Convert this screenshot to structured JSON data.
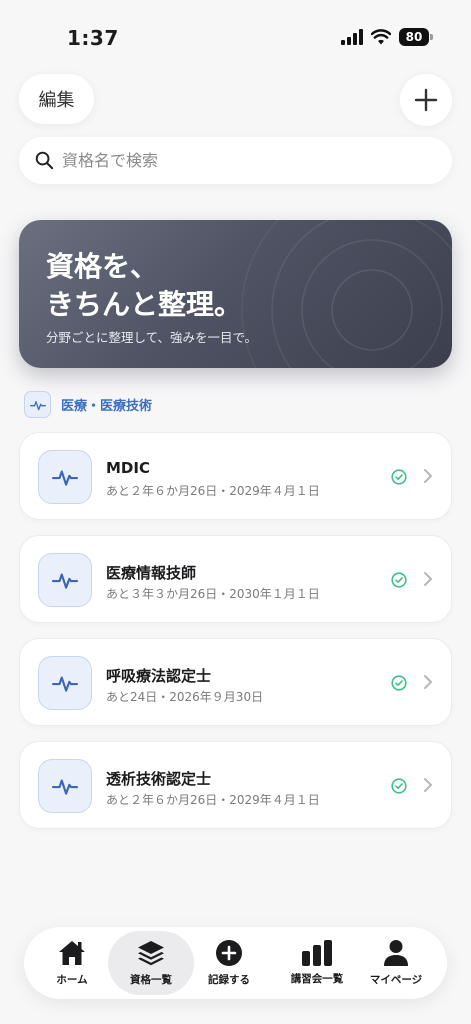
{
  "status_bar": {
    "time": "1:37",
    "battery": "80"
  },
  "header": {
    "edit_label": "編集"
  },
  "search": {
    "placeholder": "資格名で検索"
  },
  "hero": {
    "title": "資格を、\nきちんと整理。",
    "subtitle": "分野ごとに整理して、強みを一目で。"
  },
  "section": {
    "label": "医療・医療技術"
  },
  "certifications": [
    {
      "name": "MDIC",
      "meta": "あと２年６か月26日・2029年４月１日"
    },
    {
      "name": "医療情報技師",
      "meta": "あと３年３か月26日・2030年１月１日"
    },
    {
      "name": "呼吸療法認定士",
      "meta": "あと24日・2026年９月30日"
    },
    {
      "name": "透析技術認定士",
      "meta": "あと２年６か月26日・2029年４月１日"
    }
  ],
  "tabbar": {
    "items": [
      {
        "label": "ホーム",
        "icon": "home-icon"
      },
      {
        "label": "資格一覧",
        "icon": "layers-icon"
      },
      {
        "label": "記録する",
        "icon": "plus-circle-icon"
      },
      {
        "label": "講習会一覧",
        "icon": "bar-chart-icon"
      },
      {
        "label": "マイページ",
        "icon": "person-icon"
      }
    ],
    "active_index": 1
  },
  "colors": {
    "accent_blue": "#3a6fc4",
    "check_green": "#3fbf8a",
    "hero_dark": "#3b3f4d"
  }
}
